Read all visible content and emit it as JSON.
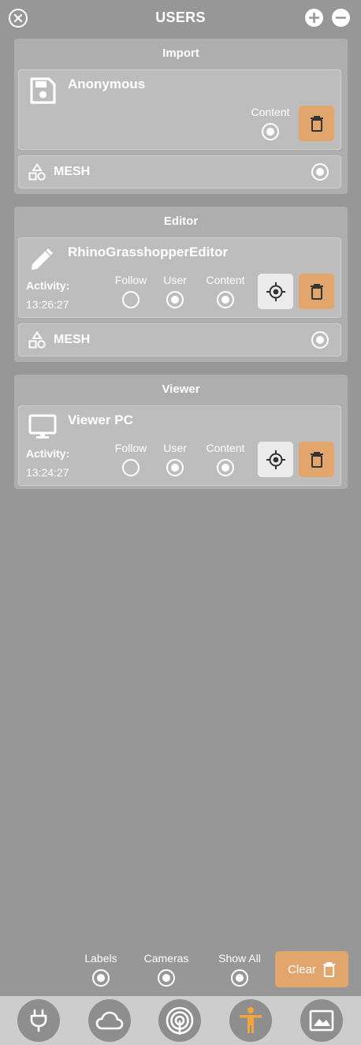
{
  "header": {
    "title": "USERS"
  },
  "sections": {
    "import": {
      "title": "Import",
      "user": {
        "name": "Anonymous",
        "icon": "floppy-disk-icon",
        "content_label": "Content",
        "content_on": true
      },
      "mesh": {
        "label": "MESH",
        "on": true
      }
    },
    "editor": {
      "title": "Editor",
      "user": {
        "name": "RhinoGrasshopperEditor",
        "icon": "pencil-icon",
        "activity_label": "Activity:",
        "activity_time": "13:26:27",
        "follow_label": "Follow",
        "user_label": "User",
        "content_label": "Content",
        "follow_on": false,
        "user_on": true,
        "content_on": true
      },
      "mesh": {
        "label": "MESH",
        "on": true
      }
    },
    "viewer": {
      "title": "Viewer",
      "user": {
        "name": "Viewer PC",
        "icon": "monitor-icon",
        "activity_label": "Activity:",
        "activity_time": "13:24:27",
        "follow_label": "Follow",
        "user_label": "User",
        "content_label": "Content",
        "follow_on": false,
        "user_on": true,
        "content_on": true
      }
    }
  },
  "footer": {
    "labels_label": "Labels",
    "cameras_label": "Cameras",
    "show_all_label": "Show All",
    "clear_label": "Clear"
  },
  "bottom_nav": [
    {
      "icon": "plug-icon"
    },
    {
      "icon": "cloud-icon"
    },
    {
      "icon": "broadcast-icon"
    },
    {
      "icon": "person-icon",
      "active": true
    },
    {
      "icon": "image-icon"
    }
  ],
  "colors": {
    "background": "#979797",
    "panel": "#aeaeae",
    "card": "#bdbdbd",
    "accent_orange": "#e2a66d",
    "active_icon": "#f0a63a",
    "bottom_bar": "#cdcdcd"
  }
}
